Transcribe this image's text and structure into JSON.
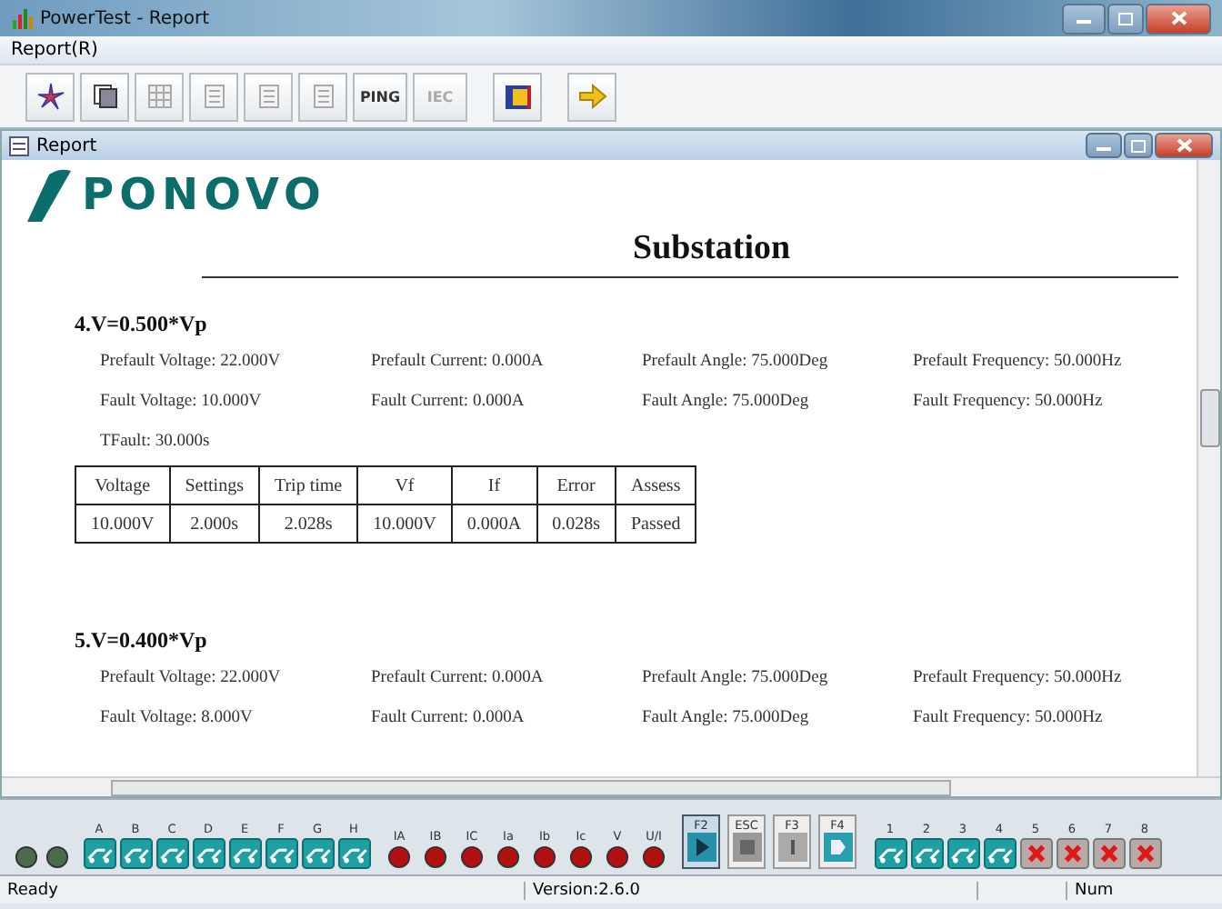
{
  "window": {
    "title": "PowerTest - Report"
  },
  "menu": [
    {
      "label": "Report(R)"
    }
  ],
  "toolbar": [
    {
      "kind": "star",
      "disabled": false
    },
    {
      "kind": "copy",
      "disabled": false
    },
    {
      "kind": "grid",
      "disabled": true
    },
    {
      "kind": "doc",
      "disabled": true
    },
    {
      "kind": "doc",
      "disabled": true
    },
    {
      "kind": "doc",
      "disabled": true
    },
    {
      "kind": "text",
      "label": "PING",
      "disabled": false
    },
    {
      "kind": "text",
      "label": "IEC",
      "disabled": true
    },
    {
      "kind": "book",
      "disabled": false
    },
    {
      "kind": "arrow",
      "disabled": false
    }
  ],
  "report": {
    "title": "Report",
    "logo": "PONOVO",
    "heading": "Substation",
    "sections": [
      {
        "title": "4.V=0.500*Vp",
        "params": [
          "Prefault Voltage: 22.000V",
          "Prefault Current: 0.000A",
          "Prefault Angle: 75.000Deg",
          "Prefault Frequency: 50.000Hz",
          "Fault Voltage: 10.000V",
          "Fault Current: 0.000A",
          "Fault Angle: 75.000Deg",
          "Fault Frequency: 50.000Hz",
          "TFault: 30.000s"
        ],
        "table": {
          "columns": [
            "Voltage",
            "Settings",
            "Trip time",
            "Vf",
            "If",
            "Error",
            "Assess"
          ],
          "rows": [
            [
              "10.000V",
              "2.000s",
              "2.028s",
              "10.000V",
              "0.000A",
              "0.028s",
              "Passed"
            ]
          ]
        }
      },
      {
        "title": "5.V=0.400*Vp",
        "params": [
          "Prefault Voltage: 22.000V",
          "Prefault Current: 0.000A",
          "Prefault Angle: 75.000Deg",
          "Prefault Frequency: 50.000Hz",
          "Fault Voltage: 8.000V",
          "Fault Current: 0.000A",
          "Fault Angle: 75.000Deg",
          "Fault Frequency: 50.000Hz"
        ]
      }
    ]
  },
  "panel": {
    "status_leds": [
      {
        "on": false
      },
      {
        "on": false
      }
    ],
    "inputs": [
      {
        "label": "A",
        "on": true
      },
      {
        "label": "B",
        "on": true
      },
      {
        "label": "C",
        "on": true
      },
      {
        "label": "D",
        "on": true
      },
      {
        "label": "E",
        "on": true
      },
      {
        "label": "F",
        "on": true
      },
      {
        "label": "G",
        "on": true
      },
      {
        "label": "H",
        "on": true
      }
    ],
    "overload_leds": [
      {
        "label": "IA",
        "on": true
      },
      {
        "label": "IB",
        "on": true
      },
      {
        "label": "IC",
        "on": true
      },
      {
        "label": "Ia",
        "on": true
      },
      {
        "label": "Ib",
        "on": true
      },
      {
        "label": "Ic",
        "on": true
      },
      {
        "label": "V",
        "on": true
      },
      {
        "label": "U/I",
        "on": true
      }
    ],
    "keys": [
      {
        "label": "F2",
        "kind": "play",
        "selected": true
      },
      {
        "label": "ESC",
        "kind": "stop",
        "selected": false
      },
      {
        "label": "F3",
        "kind": "step",
        "selected": false
      },
      {
        "label": "F4",
        "kind": "next",
        "selected": false
      }
    ],
    "outputs": [
      {
        "label": "1",
        "on": true
      },
      {
        "label": "2",
        "on": true
      },
      {
        "label": "3",
        "on": true
      },
      {
        "label": "4",
        "on": true
      },
      {
        "label": "5",
        "on": false
      },
      {
        "label": "6",
        "on": false
      },
      {
        "label": "7",
        "on": false
      },
      {
        "label": "8",
        "on": false
      }
    ]
  },
  "status_bar": {
    "message": "Ready",
    "version": "Version:2.6.0",
    "num": "Num"
  }
}
